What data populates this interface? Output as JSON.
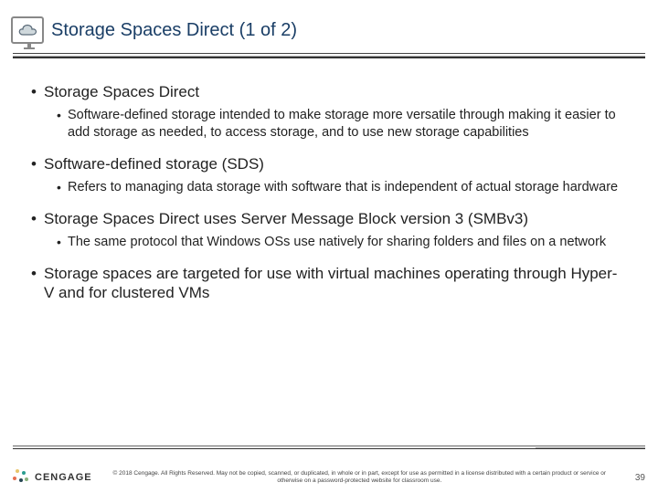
{
  "title": "Storage Spaces Direct (1 of 2)",
  "icon": "cloud-monitor-icon",
  "bullets": [
    {
      "lead": "Storage Spaces Direct",
      "sub": [
        "Software-defined storage intended to make storage more versatile through making it easier to add storage as needed, to access storage, and to use new storage capabilities"
      ]
    },
    {
      "lead": "Software-defined storage (SDS)",
      "sub": [
        "Refers to managing data storage with software that is independent of actual storage hardware"
      ]
    },
    {
      "lead": "Storage Spaces Direct uses Server Message Block version 3 (SMBv3)",
      "sub": [
        "The same protocol that Windows OSs use natively for sharing folders and files on a network"
      ]
    },
    {
      "lead": "Storage spaces are targeted for use with virtual machines operating through Hyper-V and for clustered VMs",
      "sub": []
    }
  ],
  "footer": {
    "brand": "CENGAGE",
    "copyright": "© 2018 Cengage. All Rights Reserved. May not be copied, scanned, or duplicated, in whole or in part, except for use as permitted in a license distributed with a certain product or service or otherwise on a password-protected website for classroom use.",
    "page": "39"
  }
}
